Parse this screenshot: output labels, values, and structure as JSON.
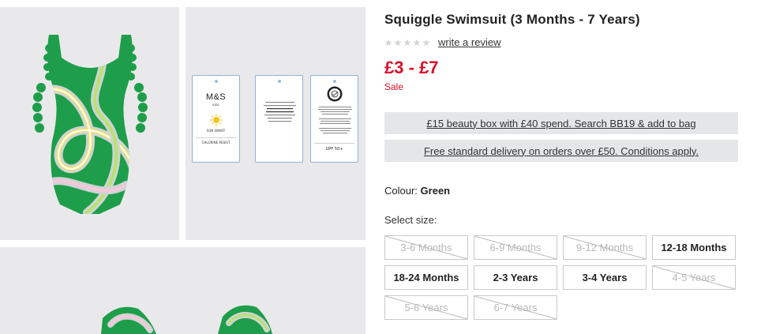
{
  "product": {
    "title": "Squiggle Swimsuit (3 Months - 7 Years)",
    "rating": {
      "stars": 0,
      "max": 5,
      "review_link": "write a review"
    },
    "price": "£3 - £7",
    "sale_label": "Sale",
    "colour_label": "Colour:",
    "colour_value": "Green",
    "select_size_label": "Select size:"
  },
  "promos": [
    {
      "text": "£15 beauty box with £40 spend. Search BB19 & add to bag"
    },
    {
      "text": "Free standard delivery on orders over £50. Conditions apply."
    }
  ],
  "sizes": [
    {
      "label": "3-6 Months",
      "available": false
    },
    {
      "label": "6-9 Months",
      "available": false
    },
    {
      "label": "9-12 Months",
      "available": false
    },
    {
      "label": "12-18 Months",
      "available": true
    },
    {
      "label": "18-24 Months",
      "available": true
    },
    {
      "label": "2-3 Years",
      "available": true
    },
    {
      "label": "3-4 Years",
      "available": true
    },
    {
      "label": "4-5 Years",
      "available": false
    },
    {
      "label": "5-6 Years",
      "available": false
    },
    {
      "label": "6-7 Years",
      "available": false
    }
  ],
  "tags": {
    "brand": "M&S",
    "kids": "KIDS",
    "sun_smart": "SUN SMART",
    "chlorine": "CHLORINE RESIST",
    "upf": "UPF 50+"
  },
  "colors": {
    "price_red": "#d8102a",
    "swimsuit_green": "#1e9e4a",
    "promo_bg": "#e5e6e8",
    "gallery_bg": "#e9e9eb"
  }
}
